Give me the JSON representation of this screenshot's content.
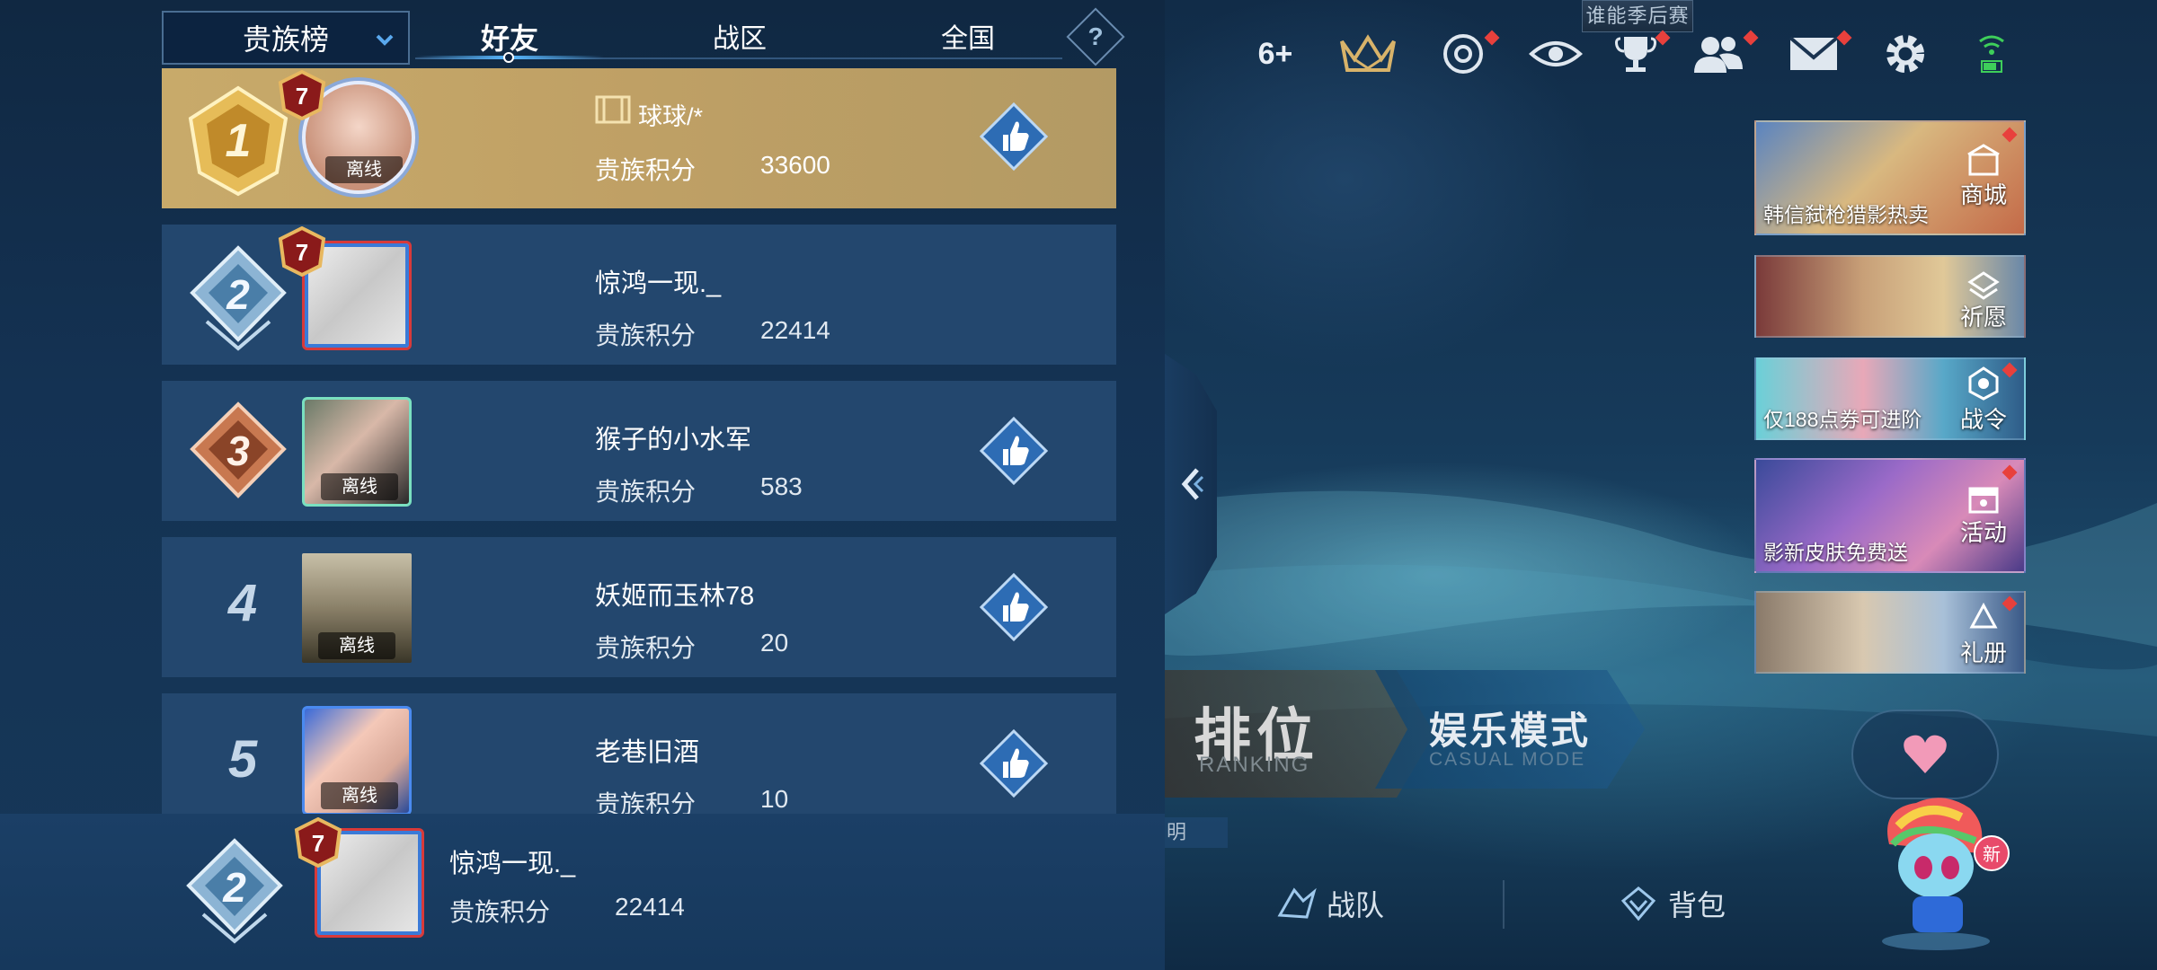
{
  "top_banner": "谁能季后赛",
  "top_bar": {
    "plus_count": "6+",
    "icons": [
      "crown-icon",
      "target-icon",
      "eye-icon",
      "trophy-icon",
      "friends-icon",
      "mail-icon",
      "gear-icon",
      "wifi-icon"
    ]
  },
  "promos": [
    {
      "caption": "韩信弑枪猎影热卖",
      "tag": "商城"
    },
    {
      "caption": "",
      "tag": "祈愿"
    },
    {
      "caption": "仅188点券可进阶",
      "tag": "战令"
    },
    {
      "caption": "影新皮肤免费送",
      "tag": "活动"
    },
    {
      "caption": "",
      "tag": "礼册"
    }
  ],
  "modes": {
    "ranking_title": "排位",
    "ranking_sub": "RANKING",
    "casual_title": "娱乐模式",
    "casual_sub": "CASUAL MODE",
    "clipped_label": "明"
  },
  "bottom_nav": {
    "team": "战队",
    "bag": "背包"
  },
  "mascot_badge": "新",
  "leaderboard": {
    "category": "贵族榜",
    "tabs": [
      "好友",
      "战区",
      "全国"
    ],
    "active_tab": "好友",
    "help": "?",
    "offline_label": "离线",
    "score_label": "贵族积分",
    "rows": [
      {
        "rank": "1",
        "name": "球球/*",
        "score": "33600",
        "level": "7",
        "offline": true,
        "like": true
      },
      {
        "rank": "2",
        "name": "惊鸿一现._",
        "score": "22414",
        "level": "7",
        "offline": false,
        "like": false
      },
      {
        "rank": "3",
        "name": "猴子的小水军",
        "score": "583",
        "level": "",
        "offline": true,
        "like": true
      },
      {
        "rank": "4",
        "name": "妖姬而玉林78",
        "score": "20",
        "level": "",
        "offline": true,
        "like": true
      },
      {
        "rank": "5",
        "name": "老巷旧酒",
        "score": "10",
        "level": "",
        "offline": true,
        "like": true
      }
    ],
    "me": {
      "rank": "2",
      "name": "惊鸿一现._",
      "score": "22414",
      "level": "7"
    }
  },
  "colors": {
    "panel_bg": "#143253",
    "row_bg": "#23476e",
    "gold_row": "#c8aa6a",
    "accent_blue": "#58b8ff",
    "like_blue": "#2d6cb4",
    "red_dot": "#e8403c"
  }
}
